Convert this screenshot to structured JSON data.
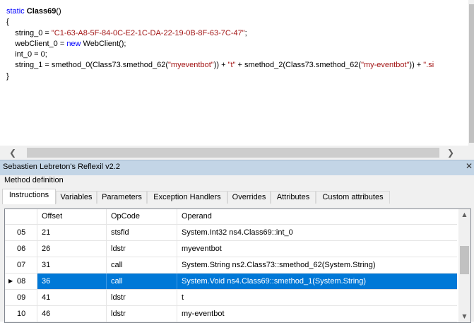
{
  "code": {
    "signature_keyword": "static",
    "signature_name": "Class69",
    "signature_parens": "()",
    "open_brace": "{",
    "close_brace": "}",
    "line1_lhs": "string_0 = ",
    "line1_str": "\"C1-63-A8-5F-84-0C-E2-1C-DA-22-19-0B-8F-63-7C-47\"",
    "line1_end": ";",
    "line2_lhs": "webClient_0 = ",
    "line2_kw": "new",
    "line2_rest": " WebClient();",
    "line3": "int_0 = 0;",
    "line4_a": "string_1 = smethod_0(Class73.smethod_62(",
    "line4_str1": "\"myeventbot\"",
    "line4_b": ")) + ",
    "line4_str2": "\"t\"",
    "line4_c": " + smethod_2(Class73.smethod_62(",
    "line4_str3": "\"my-eventbot\"",
    "line4_d": ")) + ",
    "line4_str4": "\".si"
  },
  "scroll": {
    "left_arrow": "❮",
    "right_arrow": "❯"
  },
  "plugin": {
    "title": "Sebastien Lebreton's Reflexil v2.2",
    "close_glyph": "✕",
    "group_label": "Method definition"
  },
  "tabs": [
    "Instructions",
    "Variables",
    "Parameters",
    "Exception Handlers",
    "Overrides",
    "Attributes",
    "Custom attributes"
  ],
  "grid": {
    "headers": [
      "Offset",
      "OpCode",
      "Operand"
    ],
    "rows": [
      {
        "num": "05",
        "offset": "21",
        "opcode": "stsfld",
        "operand": "System.Int32 ns4.Class69::int_0"
      },
      {
        "num": "06",
        "offset": "26",
        "opcode": "ldstr",
        "operand": "myeventbot"
      },
      {
        "num": "07",
        "offset": "31",
        "opcode": "call",
        "operand": "System.String ns2.Class73::smethod_62(System.String)"
      },
      {
        "num": "08",
        "offset": "36",
        "opcode": "call",
        "operand": "System.Void ns4.Class69::smethod_1(System.String)",
        "marker": "▶"
      },
      {
        "num": "09",
        "offset": "41",
        "opcode": "ldstr",
        "operand": "t"
      },
      {
        "num": "10",
        "offset": "46",
        "opcode": "ldstr",
        "operand": "my-eventbot"
      }
    ],
    "scroll_up": "▲",
    "scroll_down": "▼"
  },
  "colors": {
    "selection": "#0078d7",
    "keyword": "#0000ff",
    "string": "#a31515",
    "titlebar": "#c3d5e6"
  }
}
